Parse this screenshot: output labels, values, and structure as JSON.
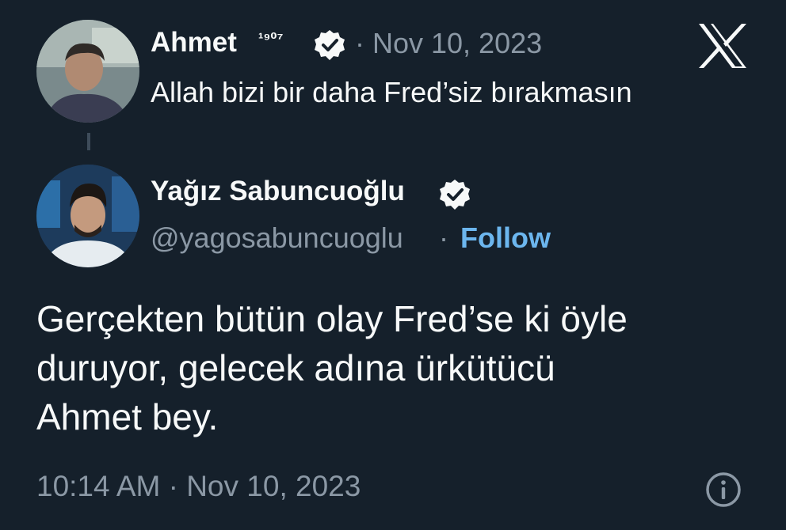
{
  "parent": {
    "name": "Ahmet",
    "name_suffix": "¹⁹⁰⁷",
    "meta": "· Nov 10, 2023",
    "text": "Allah bizi bir daha Fred’siz bırakmasın",
    "avatar_icon": "person-avatar",
    "badge_icon": "verified-badge-icon"
  },
  "logo": {
    "icon": "x-logo-icon"
  },
  "author": {
    "name": "Yağız Sabuncuoğlu",
    "handle": "@yagosabuncuoglu",
    "separator": "·",
    "follow_label": "Follow",
    "avatar_icon": "person-avatar",
    "badge_icon": "verified-badge-icon"
  },
  "tweet": {
    "lines": [
      "Gerçekten bütün olay Fred’se ki öyle",
      "duruyor, gelecek adına ürkütücü",
      "Ahmet bey."
    ]
  },
  "footer": {
    "timestamp": "10:14 AM · Nov 10, 2023",
    "info_icon": "info-icon"
  },
  "colors": {
    "background": "#15202b",
    "primary_text": "#f7f9f9",
    "secondary_text": "#8b98a5",
    "link": "#6cb6ee",
    "thread_line": "#3e4c5a"
  }
}
